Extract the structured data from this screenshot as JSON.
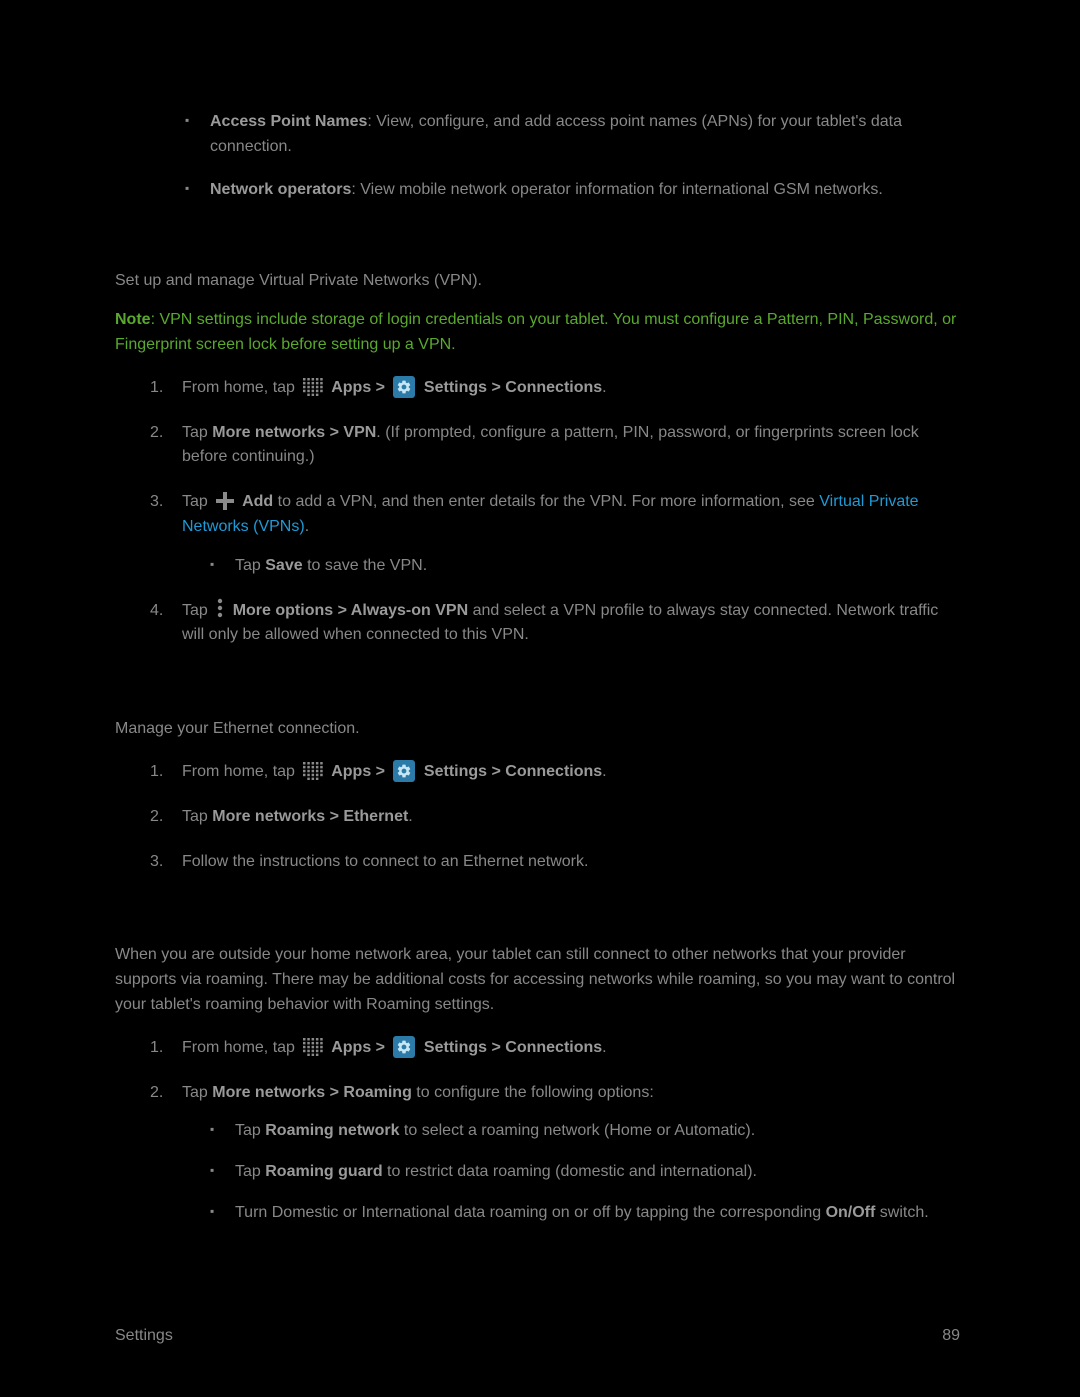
{
  "initial_bullets": [
    {
      "bold": "Access Point Names",
      "text": ": View, configure, and add access point names (APNs) for your tablet's data connection."
    },
    {
      "bold": "Network operators",
      "text": ": View mobile network operator information for international GSM networks."
    }
  ],
  "vpn": {
    "intro": "Set up and manage Virtual Private Networks (VPN).",
    "note_label": "Note",
    "note_text": ": VPN settings include storage of login credentials on your tablet. You must configure a Pattern, PIN, Password, or Fingerprint screen lock before setting up a VPN.",
    "step1_pre": "From home, tap ",
    "step1_apps": " Apps > ",
    "step1_settings": " Settings > Connections",
    "step1_end": ".",
    "step2_pre": "Tap ",
    "step2_bold": "More networks > VPN",
    "step2_post": ". (If prompted, configure a pattern, PIN, password, or fingerprints screen lock before continuing.)",
    "step3_pre": "Tap ",
    "step3_add": " Add",
    "step3_mid": " to add a VPN, and then enter details for the VPN. For more information, see ",
    "step3_link": "Virtual Private Networks (VPNs)",
    "step3_end": ".",
    "step3_sub_pre": "Tap ",
    "step3_sub_bold": "Save",
    "step3_sub_post": " to save the VPN.",
    "step4_pre": "Tap ",
    "step4_bold": " More options > Always-on VPN",
    "step4_post": " and select a VPN profile to always stay connected. Network traffic will only be allowed when connected to this VPN."
  },
  "ethernet": {
    "intro": "Manage your Ethernet connection.",
    "step1_pre": "From home, tap ",
    "step1_apps": " Apps > ",
    "step1_settings": " Settings > Connections",
    "step1_end": ".",
    "step2_pre": "Tap ",
    "step2_bold": "More networks > Ethernet",
    "step2_end": ".",
    "step3": "Follow the instructions to connect to an Ethernet network."
  },
  "roaming": {
    "intro": "When you are outside your home network area, your tablet can still connect to other networks that your provider supports via roaming. There may be additional costs for accessing networks while roaming, so you may want to control your tablet's roaming behavior with Roaming settings.",
    "step1_pre": "From home, tap ",
    "step1_apps": " Apps > ",
    "step1_settings": " Settings > Connections",
    "step1_end": ".",
    "step2_pre": "Tap ",
    "step2_bold": "More networks > Roaming",
    "step2_post": " to configure the following options:",
    "sub1_pre": "Tap ",
    "sub1_bold": "Roaming network",
    "sub1_post": " to select a roaming network (Home or Automatic).",
    "sub2_pre": "Tap ",
    "sub2_bold": "Roaming guard",
    "sub2_post": " to restrict data roaming (domestic and international).",
    "sub3_pre": "Turn Domestic or International data roaming on or off by tapping the corresponding ",
    "sub3_bold": "On/Off",
    "sub3_post": " switch."
  },
  "footer": {
    "left": "Settings",
    "right": "89"
  }
}
